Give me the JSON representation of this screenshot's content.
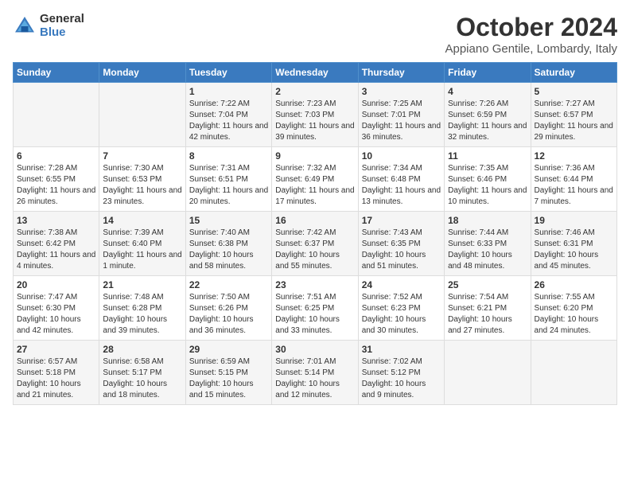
{
  "logo": {
    "general": "General",
    "blue": "Blue"
  },
  "title": "October 2024",
  "location": "Appiano Gentile, Lombardy, Italy",
  "days_header": [
    "Sunday",
    "Monday",
    "Tuesday",
    "Wednesday",
    "Thursday",
    "Friday",
    "Saturday"
  ],
  "weeks": [
    [
      {
        "day": "",
        "content": ""
      },
      {
        "day": "",
        "content": ""
      },
      {
        "day": "1",
        "content": "Sunrise: 7:22 AM\nSunset: 7:04 PM\nDaylight: 11 hours and 42 minutes."
      },
      {
        "day": "2",
        "content": "Sunrise: 7:23 AM\nSunset: 7:03 PM\nDaylight: 11 hours and 39 minutes."
      },
      {
        "day": "3",
        "content": "Sunrise: 7:25 AM\nSunset: 7:01 PM\nDaylight: 11 hours and 36 minutes."
      },
      {
        "day": "4",
        "content": "Sunrise: 7:26 AM\nSunset: 6:59 PM\nDaylight: 11 hours and 32 minutes."
      },
      {
        "day": "5",
        "content": "Sunrise: 7:27 AM\nSunset: 6:57 PM\nDaylight: 11 hours and 29 minutes."
      }
    ],
    [
      {
        "day": "6",
        "content": "Sunrise: 7:28 AM\nSunset: 6:55 PM\nDaylight: 11 hours and 26 minutes."
      },
      {
        "day": "7",
        "content": "Sunrise: 7:30 AM\nSunset: 6:53 PM\nDaylight: 11 hours and 23 minutes."
      },
      {
        "day": "8",
        "content": "Sunrise: 7:31 AM\nSunset: 6:51 PM\nDaylight: 11 hours and 20 minutes."
      },
      {
        "day": "9",
        "content": "Sunrise: 7:32 AM\nSunset: 6:49 PM\nDaylight: 11 hours and 17 minutes."
      },
      {
        "day": "10",
        "content": "Sunrise: 7:34 AM\nSunset: 6:48 PM\nDaylight: 11 hours and 13 minutes."
      },
      {
        "day": "11",
        "content": "Sunrise: 7:35 AM\nSunset: 6:46 PM\nDaylight: 11 hours and 10 minutes."
      },
      {
        "day": "12",
        "content": "Sunrise: 7:36 AM\nSunset: 6:44 PM\nDaylight: 11 hours and 7 minutes."
      }
    ],
    [
      {
        "day": "13",
        "content": "Sunrise: 7:38 AM\nSunset: 6:42 PM\nDaylight: 11 hours and 4 minutes."
      },
      {
        "day": "14",
        "content": "Sunrise: 7:39 AM\nSunset: 6:40 PM\nDaylight: 11 hours and 1 minute."
      },
      {
        "day": "15",
        "content": "Sunrise: 7:40 AM\nSunset: 6:38 PM\nDaylight: 10 hours and 58 minutes."
      },
      {
        "day": "16",
        "content": "Sunrise: 7:42 AM\nSunset: 6:37 PM\nDaylight: 10 hours and 55 minutes."
      },
      {
        "day": "17",
        "content": "Sunrise: 7:43 AM\nSunset: 6:35 PM\nDaylight: 10 hours and 51 minutes."
      },
      {
        "day": "18",
        "content": "Sunrise: 7:44 AM\nSunset: 6:33 PM\nDaylight: 10 hours and 48 minutes."
      },
      {
        "day": "19",
        "content": "Sunrise: 7:46 AM\nSunset: 6:31 PM\nDaylight: 10 hours and 45 minutes."
      }
    ],
    [
      {
        "day": "20",
        "content": "Sunrise: 7:47 AM\nSunset: 6:30 PM\nDaylight: 10 hours and 42 minutes."
      },
      {
        "day": "21",
        "content": "Sunrise: 7:48 AM\nSunset: 6:28 PM\nDaylight: 10 hours and 39 minutes."
      },
      {
        "day": "22",
        "content": "Sunrise: 7:50 AM\nSunset: 6:26 PM\nDaylight: 10 hours and 36 minutes."
      },
      {
        "day": "23",
        "content": "Sunrise: 7:51 AM\nSunset: 6:25 PM\nDaylight: 10 hours and 33 minutes."
      },
      {
        "day": "24",
        "content": "Sunrise: 7:52 AM\nSunset: 6:23 PM\nDaylight: 10 hours and 30 minutes."
      },
      {
        "day": "25",
        "content": "Sunrise: 7:54 AM\nSunset: 6:21 PM\nDaylight: 10 hours and 27 minutes."
      },
      {
        "day": "26",
        "content": "Sunrise: 7:55 AM\nSunset: 6:20 PM\nDaylight: 10 hours and 24 minutes."
      }
    ],
    [
      {
        "day": "27",
        "content": "Sunrise: 6:57 AM\nSunset: 5:18 PM\nDaylight: 10 hours and 21 minutes."
      },
      {
        "day": "28",
        "content": "Sunrise: 6:58 AM\nSunset: 5:17 PM\nDaylight: 10 hours and 18 minutes."
      },
      {
        "day": "29",
        "content": "Sunrise: 6:59 AM\nSunset: 5:15 PM\nDaylight: 10 hours and 15 minutes."
      },
      {
        "day": "30",
        "content": "Sunrise: 7:01 AM\nSunset: 5:14 PM\nDaylight: 10 hours and 12 minutes."
      },
      {
        "day": "31",
        "content": "Sunrise: 7:02 AM\nSunset: 5:12 PM\nDaylight: 10 hours and 9 minutes."
      },
      {
        "day": "",
        "content": ""
      },
      {
        "day": "",
        "content": ""
      }
    ]
  ]
}
